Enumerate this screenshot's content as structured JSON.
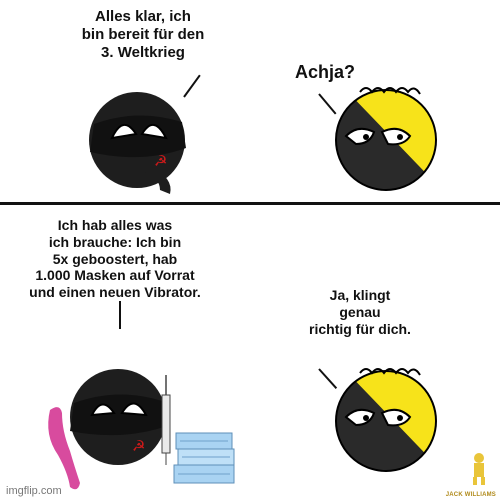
{
  "panels": [
    {
      "speech_left": "Alles klar, ich\nbin bereit für den\n3. Weltkrieg",
      "speech_right": "Achja?"
    },
    {
      "speech_left": "Ich hab alles was\nich brauche: Ich bin\n5x geboostert, hab\n1.000 Masken auf Vorrat\nund einen neuen Vibrator.",
      "speech_right": "Ja, klingt\ngenau\nrichtig für dich."
    }
  ],
  "watermark": "imgflip.com",
  "logo_text": "JACK WILLIAMS"
}
